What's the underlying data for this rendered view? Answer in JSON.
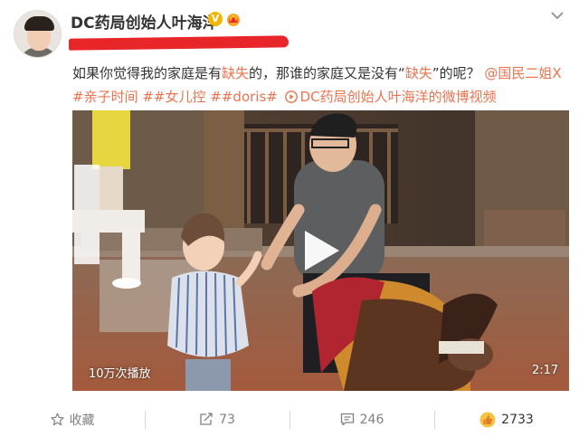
{
  "post": {
    "author": "DC药局创始人叶海洋",
    "verified_badge": "V",
    "text": {
      "p1": "如果你觉得我的家庭是有",
      "h1": "缺失",
      "p2": "的，那谁的家庭又是没有“",
      "h2": "缺失",
      "p3": "”的呢？",
      "mention": "@国民二姐X",
      "tag1": "#亲子时间",
      "tag2": "##女儿控",
      "tag3": "##doris#",
      "video_link": "DC药局创始人叶海洋的微博视频"
    }
  },
  "video": {
    "views": "10万次播放",
    "duration": "2:17"
  },
  "footer": {
    "favorite_label": "收藏",
    "repost_count": "73",
    "comment_count": "246",
    "like_count": "2733"
  },
  "colors": {
    "accent": "#eb7350",
    "redaction": "#e8262a",
    "verified": "#f4b400"
  },
  "icons": [
    "more-icon",
    "verified-icon",
    "crown-icon",
    "video-link-icon",
    "play-icon",
    "star-icon",
    "repost-icon",
    "comment-icon",
    "like-icon"
  ]
}
